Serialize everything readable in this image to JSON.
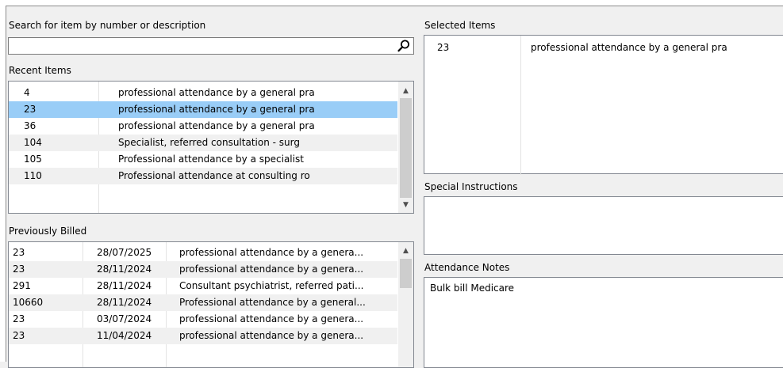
{
  "search": {
    "label": "Search for item by number or description",
    "value": "",
    "placeholder": ""
  },
  "recent": {
    "label": "Recent Items",
    "rows": [
      {
        "number": "4",
        "description": "professional attendance by a general pra"
      },
      {
        "number": "23",
        "description": "professional attendance by a general pra"
      },
      {
        "number": "36",
        "description": "professional attendance by a general pra"
      },
      {
        "number": "104",
        "description": "Specialist, referred consultation - surg"
      },
      {
        "number": "105",
        "description": "Professional attendance by a specialist"
      },
      {
        "number": "110",
        "description": "Professional attendance at consulting ro"
      }
    ],
    "selected_index": 1
  },
  "billed": {
    "label": "Previously Billed",
    "rows": [
      {
        "number": "23",
        "date": "28/07/2025",
        "description": "professional attendance by a genera..."
      },
      {
        "number": "23",
        "date": "28/11/2024",
        "description": "professional attendance by a genera..."
      },
      {
        "number": "291",
        "date": "28/11/2024",
        "description": "Consultant psychiatrist, referred pati..."
      },
      {
        "number": "10660",
        "date": "28/11/2024",
        "description": "Professional attendance by a general..."
      },
      {
        "number": "23",
        "date": "03/07/2024",
        "description": "professional attendance by a genera..."
      },
      {
        "number": "23",
        "date": "11/04/2024",
        "description": "professional attendance by a genera..."
      }
    ]
  },
  "selected": {
    "label": "Selected Items",
    "rows": [
      {
        "number": "23",
        "description": "professional attendance by a general pra"
      }
    ]
  },
  "special": {
    "label": "Special Instructions",
    "value": ""
  },
  "notes": {
    "label": "Attendance Notes",
    "value": "Bulk bill Medicare"
  },
  "icons": {
    "search": "search-icon",
    "scroll_up": "chevron-up-icon",
    "scroll_down": "chevron-down-icon"
  },
  "colors": {
    "selection": "#99cdf7",
    "alt_row": "#f0f0f0",
    "background": "#f0f0f0"
  }
}
